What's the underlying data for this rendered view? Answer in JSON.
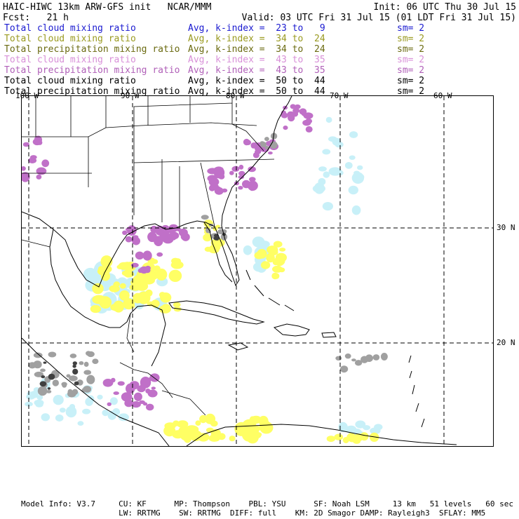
{
  "header": {
    "model_title": "HAIC-HIWC 13km ARW-GFS init   NCAR/MMM",
    "init_time": "Init: 06 UTC Thu 30 Jul 15",
    "fcst": "Fcst:   21 h",
    "valid_time": "Valid: 03 UTC Fri 31 Jul 15 (01 LDT Fri 31 Jul 15)"
  },
  "fields": [
    {
      "name": "Total cloud mixing ratio",
      "avg": "Avg, k-index =  23 to   9",
      "sm": "sm= 2",
      "color": "#1a1ad0"
    },
    {
      "name": "Total cloud mixing ratio",
      "avg": "Avg, k-index =  34 to  24",
      "sm": "sm= 2",
      "color": "#9a9a20"
    },
    {
      "name": "Total precipitation mixing ratio",
      "avg": "Avg, k-index =  34 to  24",
      "sm": "sm= 2",
      "color": "#6a6a10"
    },
    {
      "name": "Total cloud mixing ratio",
      "avg": "Avg, k-index =  43 to  35",
      "sm": "sm= 2",
      "color": "#d890d8"
    },
    {
      "name": "Total precipitation mixing ratio",
      "avg": "Avg, k-index =  43 to  35",
      "sm": "sm= 2",
      "color": "#b060b8"
    },
    {
      "name": "Total cloud mixing ratio",
      "avg": "Avg, k-index =  50 to  44",
      "sm": "sm= 2",
      "color": "#000000"
    },
    {
      "name": "Total precipitation mixing ratio",
      "avg": "Avg, k-index =  50 to  44",
      "sm": "sm= 2",
      "color": "#000000"
    }
  ],
  "map": {
    "lon_labels": [
      "100 W",
      "90 W",
      "80 W",
      "70 W",
      "60 W"
    ],
    "lat_labels": [
      "30 N",
      "20 N"
    ],
    "colors": {
      "light_blue": "#c8f0f8",
      "yellow": "#ffff64",
      "purple": "#c070c8",
      "gray": "#a0a0a0",
      "dark_gray": "#404040",
      "coast": "#000000",
      "grid": "#000000"
    }
  },
  "footer": {
    "line1": "Model Info: V3.7     CU: KF      MP: Thompson    PBL: YSU      SF: Noah LSM     13 km   51 levels   60 sec",
    "line2": "                     LW: RRTMG    SW: RRTMG  DIFF: full    KM: 2D Smagor DAMP: Rayleigh3  SFLAY: MM5"
  }
}
